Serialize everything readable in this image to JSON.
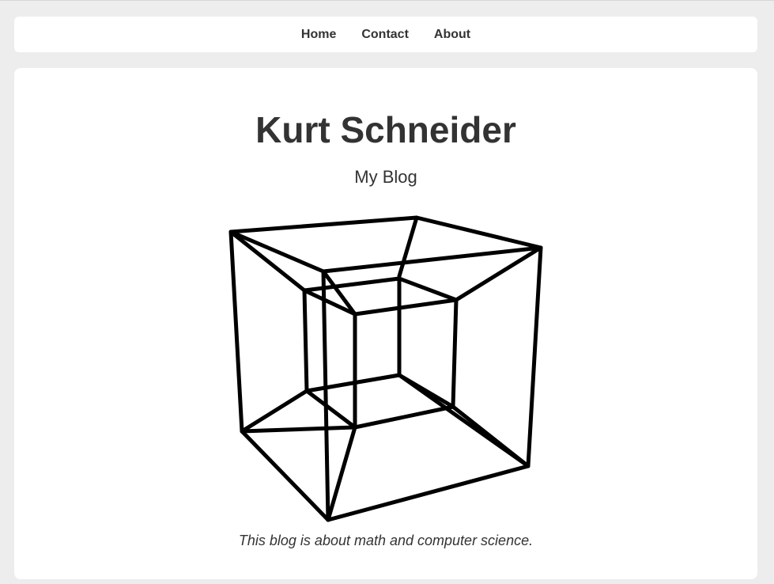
{
  "nav": {
    "items": [
      {
        "label": "Home"
      },
      {
        "label": "Contact"
      },
      {
        "label": "About"
      }
    ]
  },
  "header": {
    "title": "Kurt Schneider",
    "subtitle": "My Blog"
  },
  "hero": {
    "icon": "tesseract-icon"
  },
  "intro": {
    "text": "This blog is about math and computer science."
  }
}
